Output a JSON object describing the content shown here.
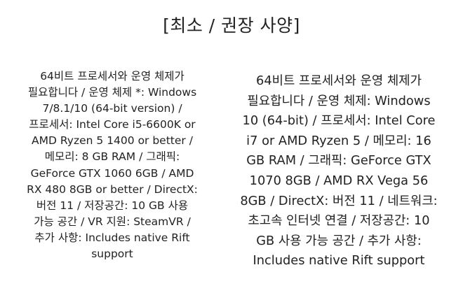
{
  "heading": "[최소 / 권장 사양]",
  "minimum": {
    "lines": [
      "64비트 프로세서와 운영 체제가",
      "필요합니다 / 운영 체제 *: Windows",
      "7/8.1/10 (64-bit version) /",
      "프로세서: Intel Core i5-6600K or",
      "AMD Ryzen 5 1400 or better /",
      "메모리: 8 GB RAM / 그래픽:",
      "GeForce GTX 1060 6GB / AMD",
      "RX 480 8GB or better / DirectX:",
      "버전 11 / 저장공간: 10 GB 사용",
      "가능 공간 / VR 지원: SteamVR /",
      "추가 사항: Includes native Rift",
      "support"
    ]
  },
  "recommended": {
    "lines": [
      "64비트 프로세서와 운영 체제가",
      "필요합니다 / 운영 체제: Windows",
      "10 (64-bit) / 프로세서: Intel Core",
      "i7 or AMD Ryzen 5 / 메모리: 16",
      "GB RAM / 그래픽: GeForce GTX",
      "1070 8GB / AMD RX Vega 56",
      "8GB / DirectX: 버전 11 / 네트워크:",
      "초고속 인터넷 연결 / 저장공간: 10",
      "GB 사용 가능 공간 / 추가 사항:",
      "Includes native Rift support"
    ]
  }
}
